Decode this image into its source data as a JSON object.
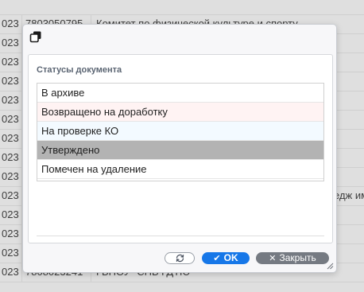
{
  "background": {
    "rows": [
      {
        "c1": "",
        "c2": "",
        "c3": "",
        "c4": ""
      },
      {
        "c1": "023",
        "c2": "7803050795",
        "c3": "Комитет по физической культуре и спорту",
        "c4": ""
      },
      {
        "c1": "023",
        "c2": "",
        "c3": "",
        "c4": ""
      },
      {
        "c1": "023",
        "c2": "",
        "c3": "",
        "c4": ""
      },
      {
        "c1": "023",
        "c2": "",
        "c3": "",
        "c4": ""
      },
      {
        "c1": "023",
        "c2": "",
        "c3": "",
        "c4": ""
      },
      {
        "c1": "023",
        "c2": "",
        "c3": "",
        "c4": ""
      },
      {
        "c1": "023",
        "c2": "",
        "c3": "",
        "c4": ""
      },
      {
        "c1": "023",
        "c2": "",
        "c3": "",
        "c4": ""
      },
      {
        "c1": "023",
        "c2": "",
        "c3": "",
        "c4": ""
      },
      {
        "c1": "023",
        "c2": "",
        "c3": "",
        "c4": "едж им"
      },
      {
        "c1": "023",
        "c2": "",
        "c3": "",
        "c4": ""
      },
      {
        "c1": "023",
        "c2": "",
        "c3": "",
        "c4": ""
      },
      {
        "c1": "023",
        "c2": "",
        "c3": "",
        "c4": ""
      },
      {
        "c1": "023",
        "c2": "7808023241",
        "c3": "ГБНОУ \"СПБ ГДТЮ\"",
        "c4": ""
      }
    ]
  },
  "dialog": {
    "copy_icon": "copy-icon",
    "panel_title": "Статусы документа",
    "statuses": [
      {
        "label": "В архиве",
        "color": "#ffffff"
      },
      {
        "label": "Возвращено на доработку",
        "color": "#fff3f3"
      },
      {
        "label": "На проверке КО",
        "color": "#f3faff"
      },
      {
        "label": "Утверждено",
        "color": "#b3b3b3"
      },
      {
        "label": "Помечен на удаление",
        "color": "#ffffff"
      }
    ],
    "buttons": {
      "refresh_icon": "refresh-icon",
      "ok_icon": "check-icon",
      "ok_label": "OK",
      "close_icon": "x-icon",
      "close_label": "Закрыть"
    },
    "colors": {
      "ok_button": "#1677e8",
      "close_button": "#757a82"
    }
  }
}
